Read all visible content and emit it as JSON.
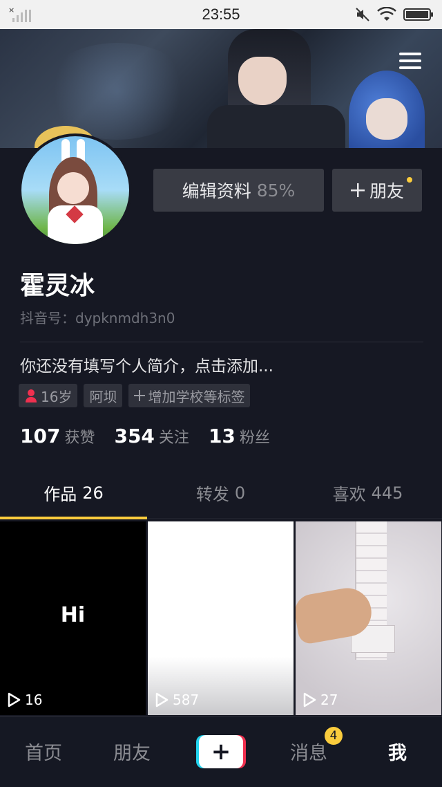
{
  "status_bar": {
    "time": "23:55",
    "icons": [
      "signal-icon",
      "mute-icon",
      "wifi-icon",
      "battery-icon"
    ]
  },
  "header": {
    "menu_icon": "hamburger-menu-icon"
  },
  "profile": {
    "edit_label": "编辑资料",
    "edit_percent": "85%",
    "add_friend_label": "朋友",
    "name": "霍灵冰",
    "douyin_id": "抖音号：dypknmdh3n0",
    "bio": "你还没有填写个人简介，点击添加...",
    "tags": {
      "age": "16岁",
      "location": "阿坝",
      "add_school": "增加学校等标签"
    },
    "stats": [
      {
        "num": "107",
        "label": "获赞"
      },
      {
        "num": "354",
        "label": "关注"
      },
      {
        "num": "13",
        "label": "粉丝"
      }
    ]
  },
  "tabs": [
    {
      "label": "作品",
      "count": "26"
    },
    {
      "label": "转发",
      "count": "0"
    },
    {
      "label": "喜欢",
      "count": "445"
    }
  ],
  "videos": [
    {
      "caption": "Hi",
      "plays": "16"
    },
    {
      "caption": "",
      "plays": "587"
    },
    {
      "caption": "",
      "plays": "27"
    }
  ],
  "bottom_nav": {
    "home": "首页",
    "friends": "朋友",
    "create": "+",
    "messages": "消息",
    "messages_badge": "4",
    "me": "我"
  },
  "colors": {
    "background": "#161823",
    "accent": "#facc3d",
    "button_bg": "#393b44"
  }
}
